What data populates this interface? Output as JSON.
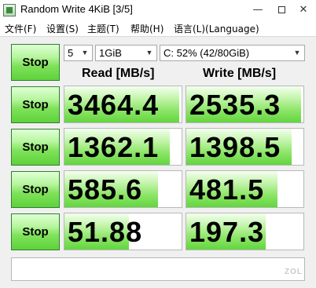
{
  "window": {
    "title": "Random Write 4KiB [3/5]",
    "minimize": "—",
    "close": "✕"
  },
  "menu": [
    "文件(F)",
    "设置(S)",
    "主题(T)",
    "帮助(H)",
    "语言(L)(Language)"
  ],
  "controls": {
    "top_button": "Stop",
    "count_select": "5",
    "size_select": "1GiB",
    "drive_select": "C: 52% (42/80GiB)"
  },
  "headers": {
    "read": "Read [MB/s]",
    "write": "Write [MB/s]"
  },
  "rows": [
    {
      "button": "Stop",
      "read": "3464.4",
      "write": "2535.3",
      "read_fill": 0.98,
      "write_fill": 0.98
    },
    {
      "button": "Stop",
      "read": "1362.1",
      "write": "1398.5",
      "read_fill": 0.9,
      "write_fill": 0.9
    },
    {
      "button": "Stop",
      "read": "585.6",
      "write": "481.5",
      "read_fill": 0.8,
      "write_fill": 0.78
    },
    {
      "button": "Stop",
      "read": "51.88",
      "write": "197.3",
      "read_fill": 0.55,
      "write_fill": 0.68
    }
  ],
  "watermark": "ZOL"
}
